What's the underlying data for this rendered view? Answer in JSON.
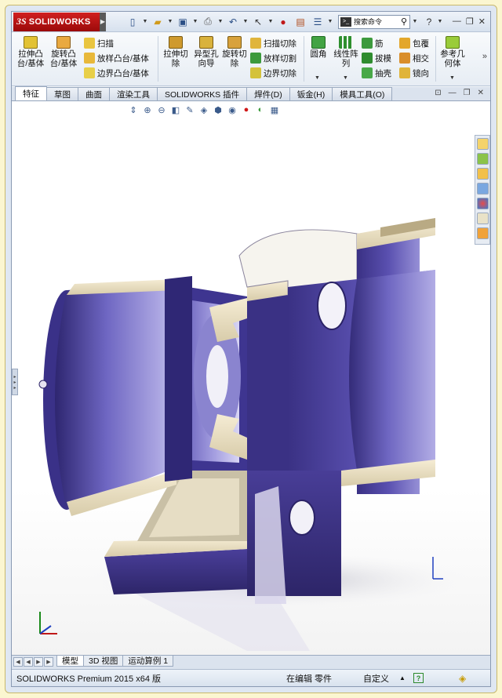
{
  "app": {
    "brand_ds": "3S",
    "brand_name": "SOLIDWORKS"
  },
  "search": {
    "placeholder": "搜索命令"
  },
  "ribbon": {
    "extrude_boss": "拉伸凸台/基体",
    "revolve_boss": "旋转凸台/基体",
    "sweep": "扫描",
    "loft_boss": "放样凸台/基体",
    "boundary_boss": "边界凸台/基体",
    "extrude_cut": "拉伸切除",
    "hole_wizard": "异型孔向导",
    "revolve_cut": "旋转切除",
    "swept_cut": "扫描切除",
    "lofted_cut": "放样切割",
    "boundary_cut": "边界切除",
    "fillet": "圆角",
    "linear_pattern": "线性阵列",
    "rib": "筋",
    "draft": "拔模",
    "shell": "抽壳",
    "wrap": "包覆",
    "intersect": "相交",
    "mirror": "镜向",
    "ref_geometry": "参考几何体",
    "more": "»"
  },
  "tabs": [
    "特征",
    "草图",
    "曲面",
    "渲染工具",
    "SOLIDWORKS 插件",
    "焊件(D)",
    "钣金(H)",
    "模具工具(O)"
  ],
  "bottom_tabs": [
    "模型",
    "3D 视图",
    "运动算例 1"
  ],
  "status": {
    "product": "SOLIDWORKS Premium 2015 x64 版",
    "state": "在编辑 零件",
    "units": "自定义",
    "units_caret": "▲",
    "help": "?"
  },
  "colors": {
    "model_face": "#4b3f9c",
    "model_highlight": "#a9a3e0",
    "brand_red": "#c0141a",
    "window_bg": "#fbf6d0"
  }
}
